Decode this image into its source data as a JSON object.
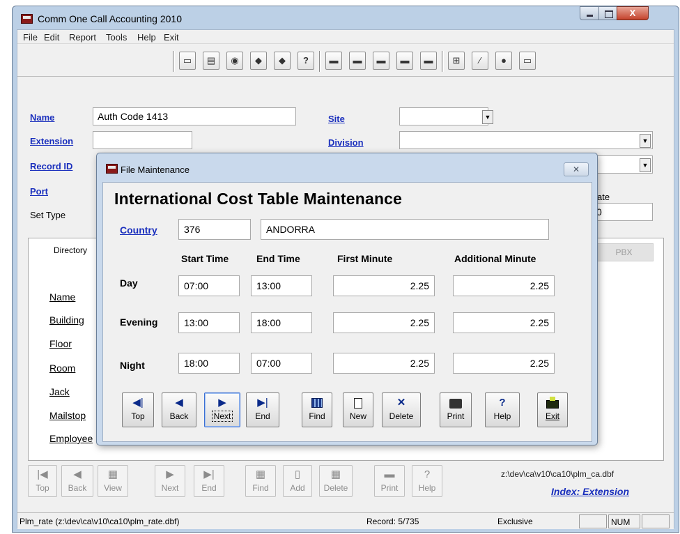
{
  "window": {
    "title": "Comm One Call Accounting 2010",
    "close_glyph": "X"
  },
  "menu": [
    "File",
    "Edit",
    "Report",
    "Tools",
    "Help",
    "Exit"
  ],
  "toolbar_icons": [
    "folder-open-icon",
    "print-icon",
    "globe-icon",
    "tag-icon",
    "tag-icon",
    "help-icon",
    "phone-icon",
    "phone-icon",
    "phone-icon",
    "phone-icon",
    "phone-icon",
    "org-chart-icon",
    "edit-icon",
    "record-icon",
    "card-icon"
  ],
  "form": {
    "name_label": "Name",
    "name_value": "Auth Code 1413",
    "extension_label": "Extension",
    "record_id_label": "Record ID",
    "port_label": "Port",
    "set_type_label": "Set Type",
    "site_label": "Site",
    "division_label": "Division",
    "rate_label": "ate",
    "rate_value": "0"
  },
  "panel": {
    "tab_directory": "Directory",
    "tab_pbx": "PBX",
    "labels": [
      "Name",
      "Building",
      "Floor",
      "Room",
      "Jack",
      "Mailstop",
      "Employee"
    ]
  },
  "bottom_nav": [
    {
      "icon": "first-icon",
      "glyph": "|◀",
      "label": "Top"
    },
    {
      "icon": "back-icon",
      "glyph": "◀",
      "label": "Back"
    },
    {
      "icon": "view-icon",
      "glyph": "▦",
      "label": "View"
    },
    {
      "icon": "next-icon",
      "glyph": "▶",
      "label": "Next"
    },
    {
      "icon": "last-icon",
      "glyph": "▶|",
      "label": "End"
    },
    {
      "icon": "find-icon",
      "glyph": "▦",
      "label": "Find"
    },
    {
      "icon": "add-icon",
      "glyph": "▯",
      "label": "Add"
    },
    {
      "icon": "delete-icon",
      "glyph": "▦",
      "label": "Delete"
    },
    {
      "icon": "print-icon",
      "glyph": "▬",
      "label": "Print"
    },
    {
      "icon": "help-icon",
      "glyph": "?",
      "label": "Help"
    }
  ],
  "dbf_path": "z:\\dev\\ca\\v10\\ca10\\plm_ca.dbf",
  "index_link": "Index: Extension",
  "status": {
    "file": "Plm_rate (z:\\dev\\ca\\v10\\ca10\\plm_rate.dbf)",
    "record": "Record: 5/735",
    "mode": "Exclusive",
    "num": "NUM"
  },
  "dialog": {
    "title": "File Maintenance",
    "close_glyph": "✕",
    "heading": "International Cost Table Maintenance",
    "country_label": "Country",
    "country_code": "376",
    "country_name": "ANDORRA",
    "headers": {
      "start": "Start Time",
      "end": "End Time",
      "first": "First Minute",
      "additional": "Additional Minute"
    },
    "rows": [
      {
        "label": "Day",
        "start": "07:00",
        "end": "13:00",
        "first": "2.25",
        "additional": "2.25"
      },
      {
        "label": "Evening",
        "start": "13:00",
        "end": "18:00",
        "first": "2.25",
        "additional": "2.25"
      },
      {
        "label": "Night",
        "start": "18:00",
        "end": "07:00",
        "first": "2.25",
        "additional": "2.25"
      }
    ],
    "buttons": {
      "top": "Top",
      "back": "Back",
      "next": "Next",
      "end": "End",
      "find": "Find",
      "new": "New",
      "delete": "Delete",
      "print": "Print",
      "help": "Help",
      "exit": "Exit"
    }
  }
}
